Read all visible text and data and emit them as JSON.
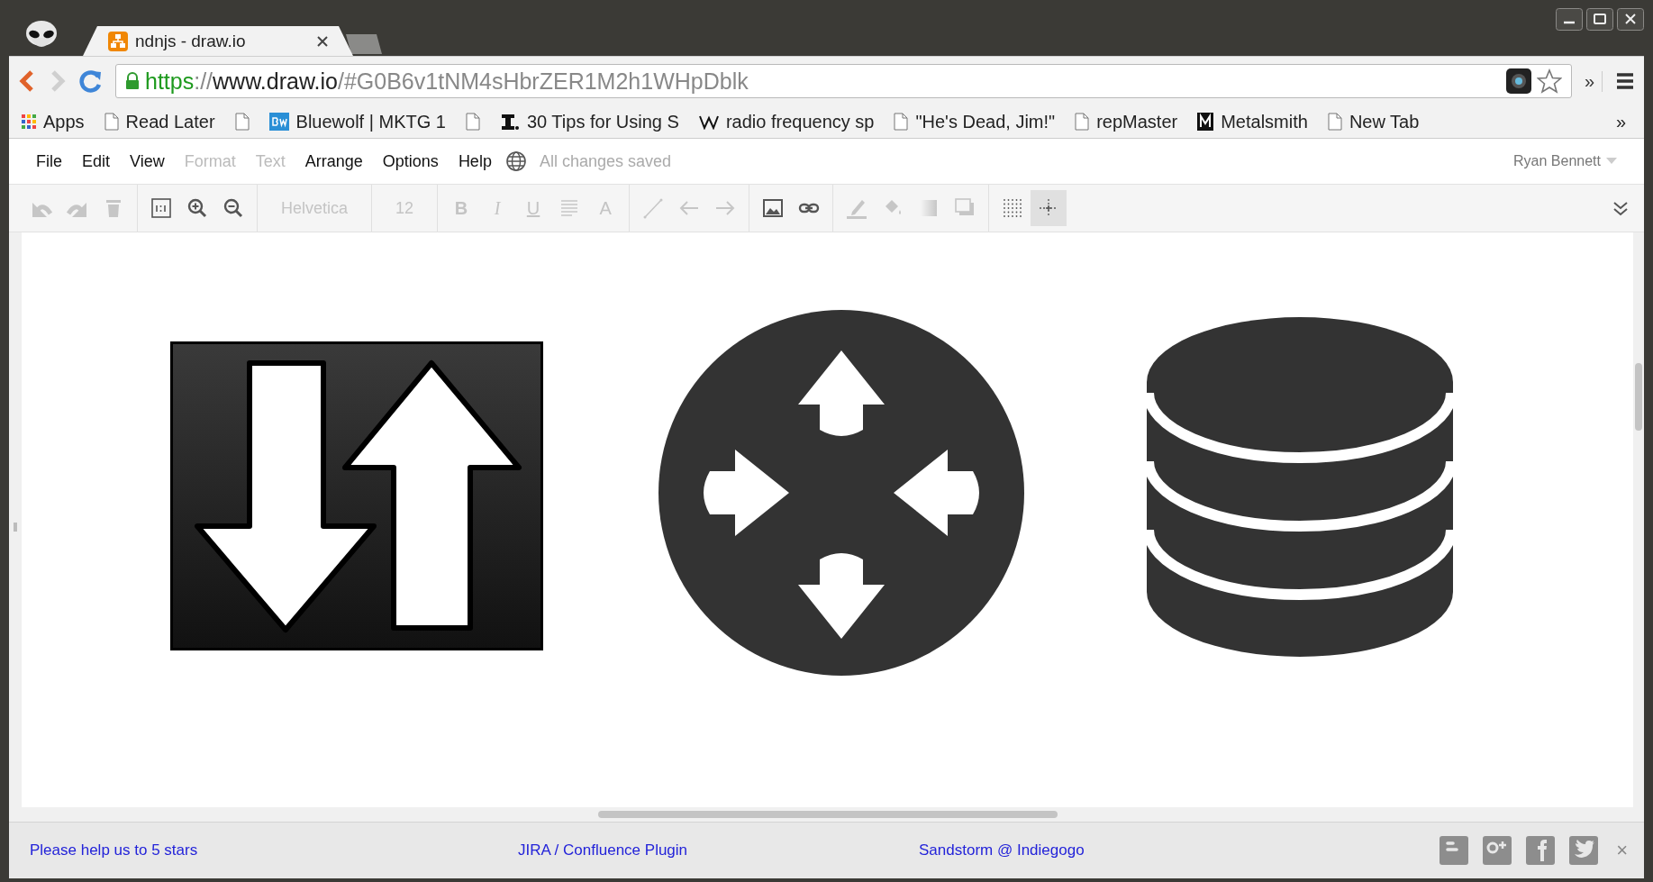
{
  "window": {
    "tabs": [
      {
        "title": "ndnjs - draw.io",
        "selected": true
      }
    ]
  },
  "address_bar": {
    "secure": true,
    "url": {
      "scheme": "https",
      "separator": "://",
      "host": "www.draw.io",
      "path": "/#G0B6v1tNM4sHbrZER1M2h1WHpDblk"
    },
    "overflow": "»"
  },
  "bookmarks": {
    "items": [
      {
        "kind": "apps",
        "label": "Apps"
      },
      {
        "kind": "page",
        "label": "Read Later"
      },
      {
        "kind": "page"
      },
      {
        "kind": "bw",
        "label": "Bluewolf | MKTG 1"
      },
      {
        "kind": "page"
      },
      {
        "kind": "ibeam",
        "label": "30 Tips for Using S"
      },
      {
        "kind": "wiki",
        "label": "radio frequency sp"
      },
      {
        "kind": "page",
        "label": "\"He's Dead, Jim!\""
      },
      {
        "kind": "page",
        "label": "repMaster"
      },
      {
        "kind": "m",
        "label": "Metalsmith"
      },
      {
        "kind": "page",
        "label": "New Tab"
      }
    ],
    "overflow": "»"
  },
  "menu": {
    "items": [
      {
        "label": "File",
        "disabled": false
      },
      {
        "label": "Edit",
        "disabled": false
      },
      {
        "label": "View",
        "disabled": false
      },
      {
        "label": "Format",
        "disabled": true
      },
      {
        "label": "Text",
        "disabled": true
      },
      {
        "label": "Arrange",
        "disabled": false
      },
      {
        "label": "Options",
        "disabled": false
      },
      {
        "label": "Help",
        "disabled": false
      }
    ],
    "status": "All changes saved",
    "user": "Ryan Bennett"
  },
  "toolbar": {
    "groups": [
      {
        "items": [
          {
            "kind": "icon",
            "disabled": true
          },
          {
            "kind": "icon",
            "disabled": true
          },
          {
            "kind": "icon",
            "disabled": true
          }
        ]
      },
      {
        "items": [
          {
            "kind": "icon",
            "disabled": false
          },
          {
            "kind": "icon",
            "disabled": false
          },
          {
            "kind": "icon",
            "disabled": false
          }
        ]
      },
      {
        "items": [
          {
            "kind": "field",
            "value": "Helvetica",
            "disabled": true
          }
        ]
      },
      {
        "items": [
          {
            "kind": "field",
            "value": "12",
            "disabled": true
          }
        ]
      },
      {
        "items": [
          {
            "kind": "glyph",
            "label": "B",
            "disabled": true
          },
          {
            "kind": "glyph",
            "label": "I",
            "disabled": true
          },
          {
            "kind": "glyph",
            "label": "U",
            "disabled": true
          },
          {
            "kind": "icon",
            "disabled": true
          },
          {
            "kind": "glyph",
            "label": "A",
            "disabled": true
          }
        ]
      },
      {
        "items": [
          {
            "kind": "icon",
            "disabled": true
          },
          {
            "kind": "icon",
            "disabled": true
          },
          {
            "kind": "icon",
            "disabled": true
          }
        ]
      },
      {
        "items": [
          {
            "kind": "icon",
            "disabled": false
          },
          {
            "kind": "icon",
            "disabled": false
          }
        ]
      },
      {
        "items": [
          {
            "kind": "icon",
            "disabled": true
          },
          {
            "kind": "icon",
            "disabled": true
          },
          {
            "kind": "icon",
            "disabled": true
          },
          {
            "kind": "icon",
            "disabled": true
          }
        ]
      },
      {
        "items": [
          {
            "kind": "icon",
            "disabled": false,
            "selected": false
          },
          {
            "kind": "icon",
            "disabled": false,
            "selected": true
          }
        ]
      }
    ]
  },
  "canvas": {
    "shapes": [
      {
        "kind": "arrows"
      },
      {
        "kind": "router"
      },
      {
        "kind": "database"
      }
    ]
  },
  "footer": {
    "links": [
      "Please help us to 5 stars",
      "JIRA / Confluence Plugin",
      "Sandstorm @ Indiegogo"
    ],
    "close": "×"
  }
}
